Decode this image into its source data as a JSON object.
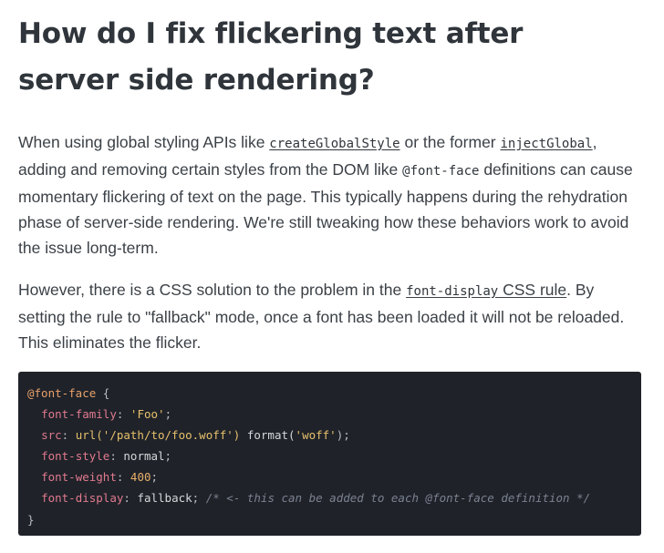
{
  "heading": "How do I fix flickering text after server side rendering?",
  "paragraph1": {
    "t1": "When using global styling APIs like ",
    "code1": "createGlobalStyle",
    "t2": " or the former ",
    "code2": "injectGlobal",
    "t3": ", adding and removing certain styles from the DOM like ",
    "code3": "@font-face",
    "t4": " definitions can cause momentary flickering of text on the page. This typically happens during the rehydration phase of server-side rendering. We're still tweaking how these behaviors work to avoid the issue long-term."
  },
  "paragraph2": {
    "t1": "However, there is a CSS solution to the problem in the ",
    "link_code": "font-display",
    "link_text": " CSS rule",
    "t2": ". By setting the rule to \"fallback\" mode, once a font has been loaded it will not be reloaded. This eliminates the flicker."
  },
  "code": {
    "l1_at": "@font-face",
    "l1_brace": " {",
    "l2_prop": "font-family",
    "l2_colon": ": ",
    "l2_val": "'Foo'",
    "l2_end": ";",
    "l3_prop": "src",
    "l3_colon": ": ",
    "l3_url": "url('/path/to/foo.woff')",
    "l3_fmt": " format(",
    "l3_fmtval": "'woff'",
    "l3_end": ");",
    "l4_prop": "font-style",
    "l4_colon": ": ",
    "l4_val": "normal",
    "l4_end": ";",
    "l5_prop": "font-weight",
    "l5_colon": ": ",
    "l5_val": "400",
    "l5_end": ";",
    "l6_prop": "font-display",
    "l6_colon": ": ",
    "l6_val": "fallback",
    "l6_end": "; ",
    "l6_comment": "/* <- this can be added to each @font-face definition */",
    "l7_brace": "}"
  },
  "colors": {
    "heading": "#2f353b",
    "body_text": "#3b4147",
    "code_bg": "#1f2229",
    "code_property": "#e07a8e",
    "code_string": "#e6c16b",
    "code_comment": "#7b8290"
  }
}
